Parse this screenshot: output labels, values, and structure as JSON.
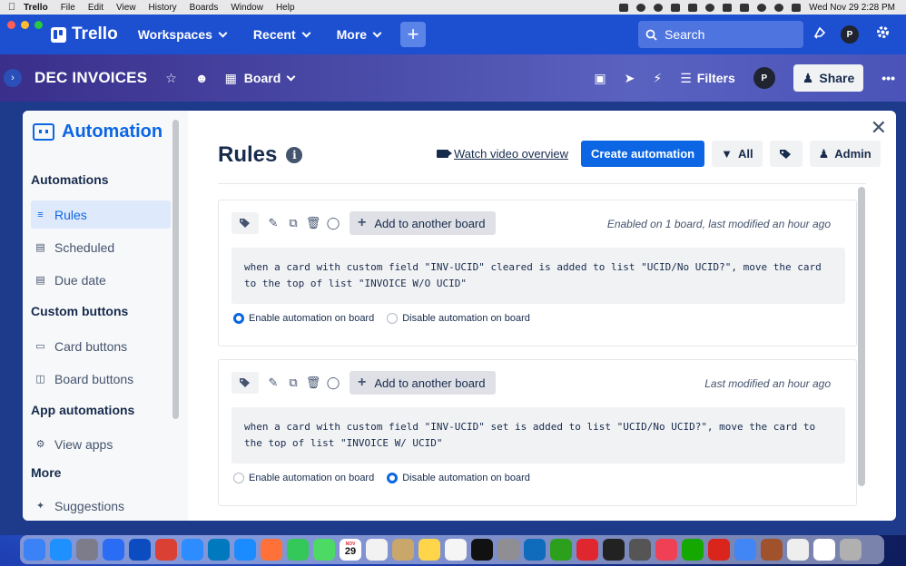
{
  "menubar": {
    "app": "Trello",
    "items": [
      "File",
      "Edit",
      "View",
      "History",
      "Boards",
      "Window",
      "Help"
    ],
    "clock": "Wed Nov 29  2:28 PM"
  },
  "topnav": {
    "logo": "Trello",
    "menus": [
      "Workspaces",
      "Recent",
      "More"
    ],
    "search_placeholder": "Search",
    "avatar_initial": "P"
  },
  "board": {
    "title": "DEC INVOICES",
    "view": "Board",
    "filters": "Filters",
    "avatar_initial": "P",
    "share": "Share"
  },
  "sidebar": {
    "title": "Automation",
    "sections": [
      {
        "label": "Automations",
        "items": [
          {
            "label": "Rules",
            "icon": "sliders-icon",
            "active": true
          },
          {
            "label": "Scheduled",
            "icon": "calendar-icon",
            "active": false
          },
          {
            "label": "Due date",
            "icon": "calendar-icon",
            "active": false
          }
        ]
      },
      {
        "label": "Custom buttons",
        "items": [
          {
            "label": "Card buttons",
            "icon": "card-icon",
            "active": false
          },
          {
            "label": "Board buttons",
            "icon": "board-icon",
            "active": false
          }
        ]
      },
      {
        "label": "App automations",
        "items": [
          {
            "label": "View apps",
            "icon": "gear-icon",
            "active": false
          }
        ]
      },
      {
        "label": "More",
        "items": [
          {
            "label": "Suggestions",
            "icon": "sparkle-icon",
            "active": false
          }
        ]
      }
    ]
  },
  "main": {
    "title": "Rules",
    "video_link": "Watch video overview",
    "create_button": "Create automation",
    "filter_all": "All",
    "admin": "Admin"
  },
  "rules": [
    {
      "add_board": "Add to another board",
      "meta": "Enabled on 1 board, last modified an hour ago",
      "description": "when a card with custom field \"INV-UCID\" cleared is added to list \"UCID/No UCID?\", move the card to the top of list \"INVOICE W/O UCID\"",
      "enable_label": "Enable automation on board",
      "disable_label": "Disable automation on board",
      "enabled": true
    },
    {
      "add_board": "Add to another board",
      "meta": "Last modified an hour ago",
      "description": "when a card with custom field \"INV-UCID\" set is added to list \"UCID/No UCID?\", move the card to the top of list \"INVOICE W/ UCID\"",
      "enable_label": "Enable automation on board",
      "disable_label": "Disable automation on board",
      "enabled": false
    }
  ],
  "dock": {
    "calendar_month": "NOV",
    "calendar_day": "29",
    "icons": [
      "finder-icon",
      "app-store-icon",
      "launchpad-icon",
      "testflight-icon",
      "1password-icon",
      "todoist-icon",
      "zoom-icon",
      "trello-icon",
      "safari-icon",
      "firefox-icon",
      "facetime-icon",
      "maps-icon",
      "calendar-icon",
      "reminders-icon",
      "contacts-icon",
      "notes-icon",
      "freeform-icon",
      "tv-icon",
      "settings-icon",
      "outlook-icon",
      "quickbooks-icon",
      "acrobat-cloud-icon",
      "activity-monitor-icon",
      "calculator-icon",
      "pocket-icon",
      "upwork-icon",
      "acrobat-icon",
      "chrome-icon",
      "dictionary-icon",
      "document-icon",
      "pdf-icon",
      "trash-icon"
    ]
  },
  "colors": {
    "trello_blue": "#1d4fd1",
    "primary": "#0c66e4",
    "text": "#172b4d"
  }
}
